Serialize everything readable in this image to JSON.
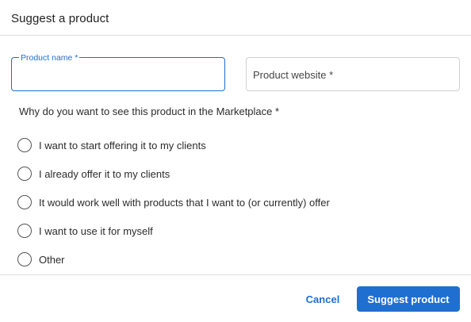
{
  "dialog": {
    "title": "Suggest a product"
  },
  "fields": {
    "product_name": {
      "label": "Product name *",
      "value": ""
    },
    "product_website": {
      "placeholder": "Product website *",
      "value": ""
    }
  },
  "question": {
    "text": "Why do you want to see this product in the Marketplace *",
    "options": [
      {
        "label": "I want to start offering it to my clients",
        "selected": false
      },
      {
        "label": "I already offer it to my clients",
        "selected": false
      },
      {
        "label": "It would work well with products that I want to (or currently) offer",
        "selected": false
      },
      {
        "label": "I want to use it for myself",
        "selected": false
      },
      {
        "label": "Other",
        "selected": false
      }
    ]
  },
  "footer": {
    "cancel_label": "Cancel",
    "submit_label": "Suggest product"
  },
  "colors": {
    "accent": "#1f6fd1",
    "border": "#d0d0d0",
    "divider": "#dcdcdc"
  }
}
